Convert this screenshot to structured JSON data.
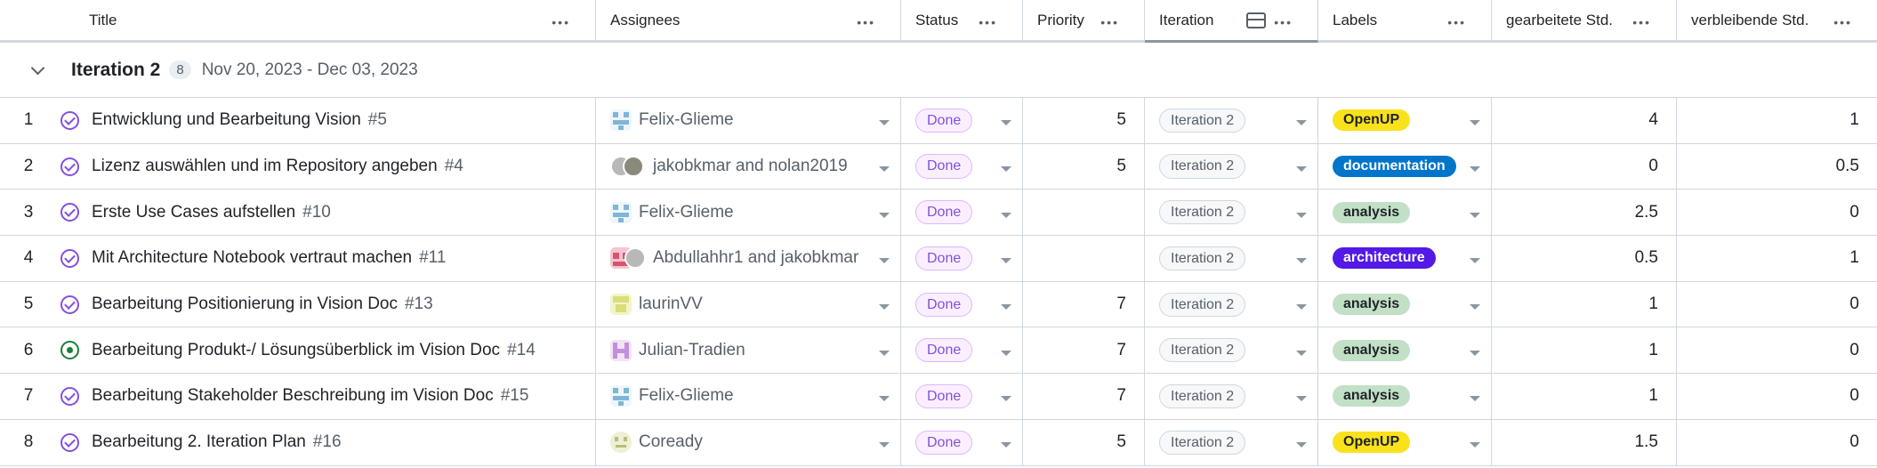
{
  "columns": [
    {
      "label": "Title"
    },
    {
      "label": "Assignees"
    },
    {
      "label": "Status"
    },
    {
      "label": "Priority"
    },
    {
      "label": "Iteration"
    },
    {
      "label": "Labels"
    },
    {
      "label": "gearbeitete Std."
    },
    {
      "label": "verbleibende Std."
    }
  ],
  "group": {
    "title": "Iteration 2",
    "count": "8",
    "dates": "Nov 20, 2023 - Dec 03, 2023"
  },
  "rows": [
    {
      "n": "1",
      "state": "closed",
      "title": "Entwicklung und Bearbeitung Vision",
      "issue": "#5",
      "assignees": "Felix-Glieme",
      "avatar": "felix",
      "status": "Done",
      "priority": "5",
      "iteration": "Iteration 2",
      "label": "OpenUP",
      "label_bg": "#f9e21b",
      "label_fg": "#1f2328",
      "worked": "4",
      "remaining": "1"
    },
    {
      "n": "2",
      "state": "closed",
      "title": "Lizenz auswählen und im Repository angeben",
      "issue": "#4",
      "assignees": "jakobkmar and nolan2019",
      "avatar": "jakob-nolan",
      "status": "Done",
      "priority": "5",
      "iteration": "Iteration 2",
      "label": "documentation",
      "label_bg": "#0075ca",
      "label_fg": "#ffffff",
      "worked": "0",
      "remaining": "0.5"
    },
    {
      "n": "3",
      "state": "closed",
      "title": "Erste Use Cases aufstellen",
      "issue": "#10",
      "assignees": "Felix-Glieme",
      "avatar": "felix",
      "status": "Done",
      "priority": "",
      "iteration": "Iteration 2",
      "label": "analysis",
      "label_bg": "#c2e0c6",
      "label_fg": "#1f2328",
      "worked": "2.5",
      "remaining": "0"
    },
    {
      "n": "4",
      "state": "closed",
      "title": "Mit Architecture Notebook vertraut machen",
      "issue": "#11",
      "assignees": "Abdullahhr1 and jakobkmar",
      "avatar": "abdul-jakob",
      "status": "Done",
      "priority": "",
      "iteration": "Iteration 2",
      "label": "architecture",
      "label_bg": "#5319e7",
      "label_fg": "#ffffff",
      "worked": "0.5",
      "remaining": "1"
    },
    {
      "n": "5",
      "state": "closed",
      "title": "Bearbeitung Positionierung in Vision Doc",
      "issue": "#13",
      "assignees": "laurinVV",
      "avatar": "laurin",
      "status": "Done",
      "priority": "7",
      "iteration": "Iteration 2",
      "label": "analysis",
      "label_bg": "#c2e0c6",
      "label_fg": "#1f2328",
      "worked": "1",
      "remaining": "0"
    },
    {
      "n": "6",
      "state": "open",
      "title": "Bearbeitung Produkt-/ Lösungsüberblick im Vision Doc",
      "issue": "#14",
      "assignees": "Julian-Tradien",
      "avatar": "julian",
      "status": "Done",
      "priority": "7",
      "iteration": "Iteration 2",
      "label": "analysis",
      "label_bg": "#c2e0c6",
      "label_fg": "#1f2328",
      "worked": "1",
      "remaining": "0"
    },
    {
      "n": "7",
      "state": "closed",
      "title": "Bearbeitung Stakeholder Beschreibung im Vision Doc",
      "issue": "#15",
      "assignees": "Felix-Glieme",
      "avatar": "felix",
      "status": "Done",
      "priority": "7",
      "iteration": "Iteration 2",
      "label": "analysis",
      "label_bg": "#c2e0c6",
      "label_fg": "#1f2328",
      "worked": "1",
      "remaining": "0"
    },
    {
      "n": "8",
      "state": "closed",
      "title": "Bearbeitung 2. Iteration Plan",
      "issue": "#16",
      "assignees": "Coready",
      "avatar": "coready",
      "status": "Done",
      "priority": "5",
      "iteration": "Iteration 2",
      "label": "OpenUP",
      "label_bg": "#f9e21b",
      "label_fg": "#1f2328",
      "worked": "1.5",
      "remaining": "0"
    }
  ],
  "colors": {
    "done_status": "#8250df",
    "open_state": "#1a7f37",
    "border": "#d0d7de"
  }
}
